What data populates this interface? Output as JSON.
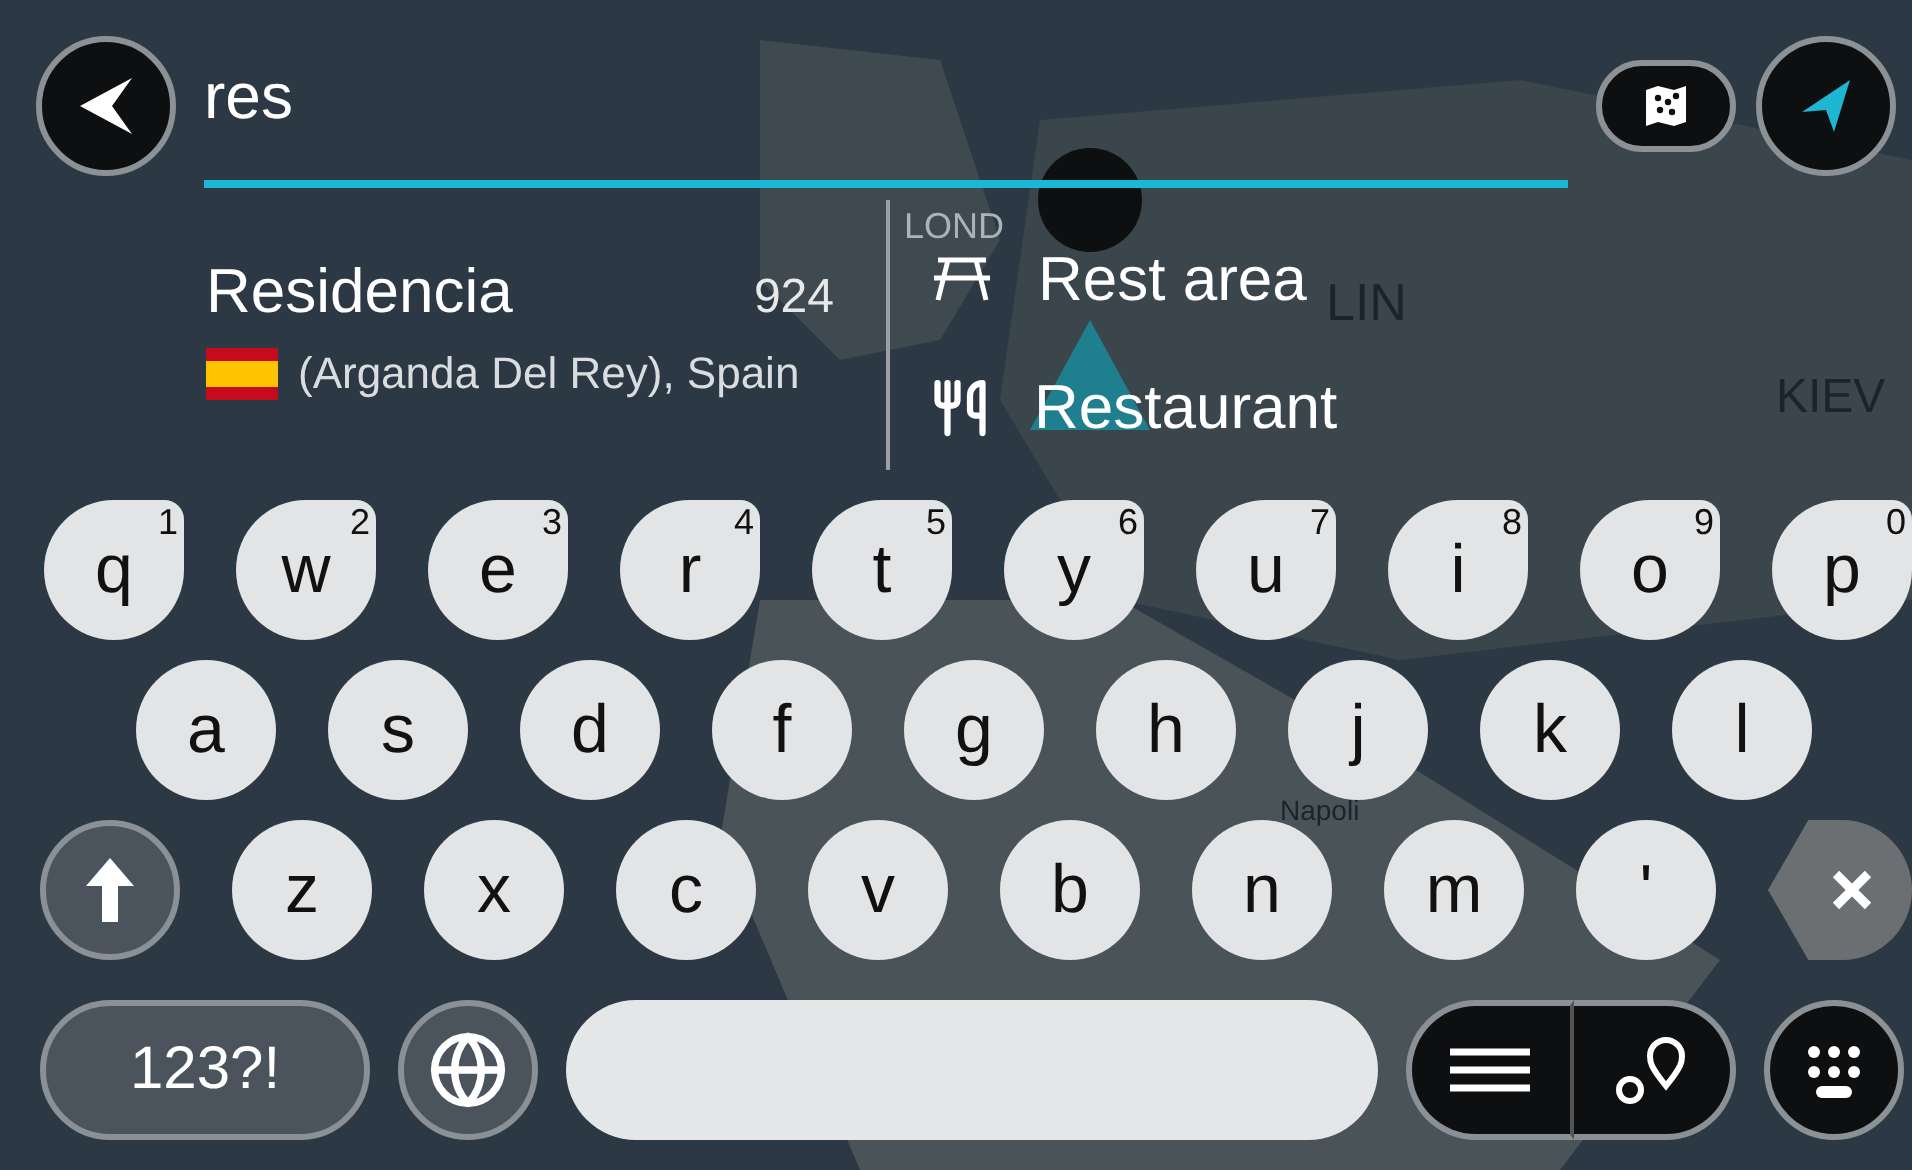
{
  "search": {
    "value": "res"
  },
  "result": {
    "name": "Residencia",
    "distance": "924",
    "location": "(Arganda Del Rey), Spain"
  },
  "categories": [
    {
      "label": "Rest area",
      "kind": "rest"
    },
    {
      "label": "Restaurant",
      "kind": "food"
    }
  ],
  "map_labels": [
    "LOND",
    "LIN",
    "KIEV",
    "Napoli"
  ],
  "keyboard": {
    "rows": [
      [
        {
          "key": "q",
          "sup": "1"
        },
        {
          "key": "w",
          "sup": "2"
        },
        {
          "key": "e",
          "sup": "3"
        },
        {
          "key": "r",
          "sup": "4"
        },
        {
          "key": "t",
          "sup": "5"
        },
        {
          "key": "y",
          "sup": "6"
        },
        {
          "key": "u",
          "sup": "7"
        },
        {
          "key": "i",
          "sup": "8"
        },
        {
          "key": "o",
          "sup": "9"
        },
        {
          "key": "p",
          "sup": "0"
        }
      ],
      [
        {
          "key": "a"
        },
        {
          "key": "s"
        },
        {
          "key": "d"
        },
        {
          "key": "f"
        },
        {
          "key": "g"
        },
        {
          "key": "h"
        },
        {
          "key": "j"
        },
        {
          "key": "k"
        },
        {
          "key": "l"
        }
      ],
      [
        {
          "key": "z"
        },
        {
          "key": "x"
        },
        {
          "key": "c"
        },
        {
          "key": "v"
        },
        {
          "key": "b"
        },
        {
          "key": "n"
        },
        {
          "key": "m"
        },
        {
          "key": "'"
        }
      ]
    ],
    "mode_key": "123?!"
  }
}
